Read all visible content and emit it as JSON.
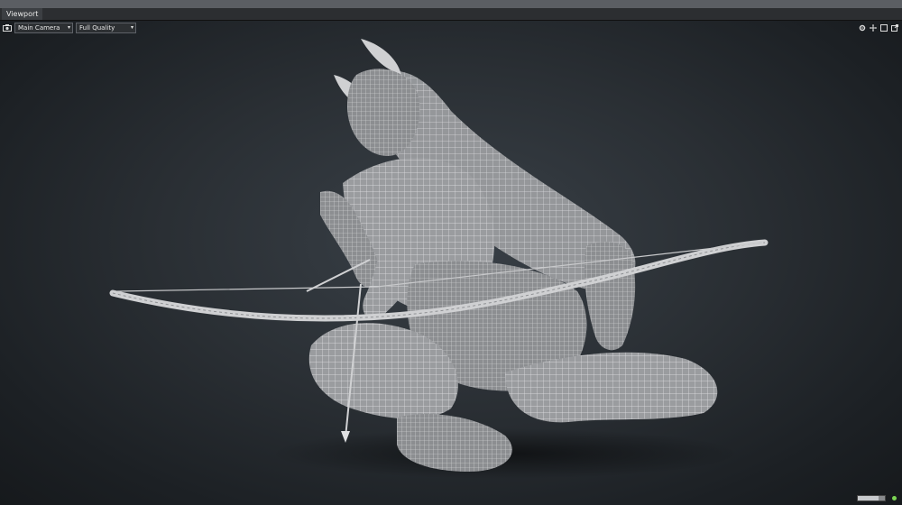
{
  "window": {
    "tab_label": "Viewport",
    "close_glyph": "✕"
  },
  "toolbar": {
    "camera_icon": "camera-icon",
    "camera_select": "Main Camera",
    "quality_select": "Full Quality",
    "dropdown_glyph": "▾"
  },
  "right_tools": {
    "icons": [
      "gear-icon",
      "move-icon",
      "maximize-icon",
      "popout-icon"
    ]
  },
  "status": {
    "progress": 0.75,
    "indicator_color": "#7bd453"
  },
  "scene": {
    "subject": "",
    "mesh_color": "#b8b9bb",
    "wire_color": "#e6e7e9"
  }
}
